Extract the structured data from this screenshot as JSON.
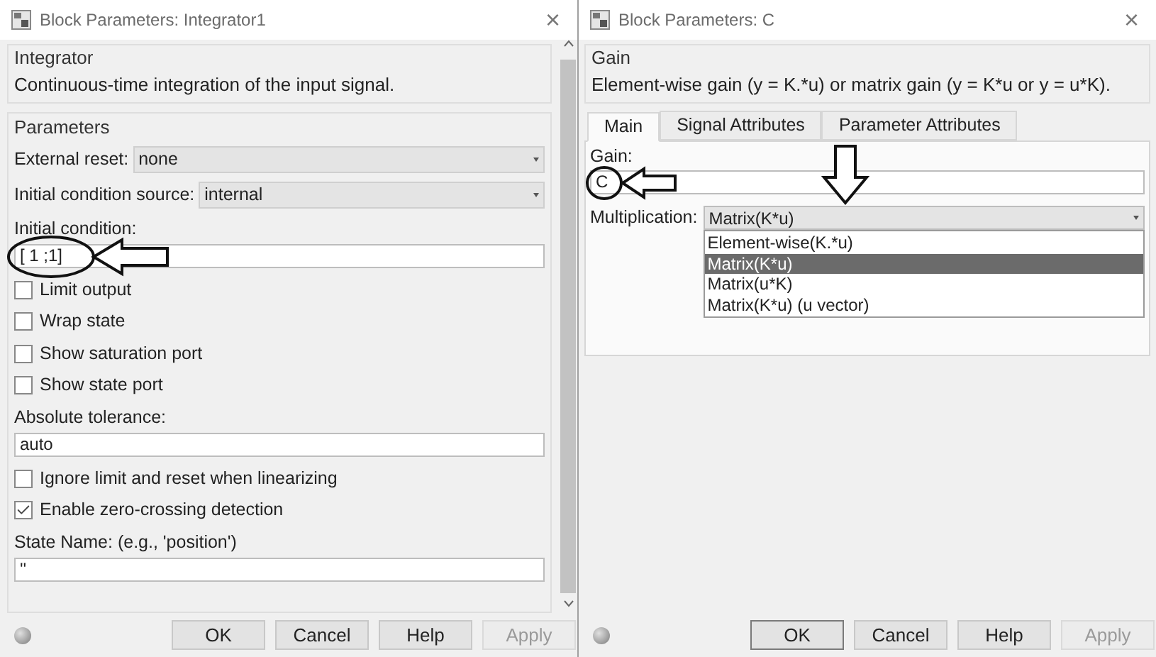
{
  "integrator_dialog": {
    "title": "Block Parameters: Integrator1",
    "close": "×",
    "block": {
      "name": "Integrator",
      "description": "Continuous-time integration of the input signal."
    },
    "group": "Parameters",
    "fields": [
      {
        "kind": "select",
        "label": "External reset:",
        "value": "none"
      },
      {
        "kind": "select",
        "label": "Initial condition source:",
        "value": "internal"
      },
      {
        "kind": "text",
        "label": "Initial condition:",
        "value": "[ 1 ;1]",
        "annotated": true
      },
      {
        "kind": "checkbox",
        "label": "Limit output",
        "checked": false
      },
      {
        "kind": "checkbox",
        "label": "Wrap state",
        "checked": false
      },
      {
        "kind": "checkbox",
        "label": "Show saturation port",
        "checked": false
      },
      {
        "kind": "checkbox",
        "label": "Show state port",
        "checked": false
      },
      {
        "kind": "text",
        "label": "Absolute tolerance:",
        "value": "auto",
        "annotated": false
      },
      {
        "kind": "checkbox",
        "label": "Ignore limit and reset when linearizing",
        "checked": false
      },
      {
        "kind": "checkbox",
        "label": "Enable zero-crossing detection",
        "checked": true
      },
      {
        "kind": "text",
        "label": "State Name: (e.g., 'position')",
        "value": "''",
        "annotated": false
      }
    ],
    "buttons": [
      {
        "label": "OK",
        "disabled": false,
        "focused": false
      },
      {
        "label": "Cancel",
        "disabled": false,
        "focused": false
      },
      {
        "label": "Help",
        "disabled": false,
        "focused": false
      },
      {
        "label": "Apply",
        "disabled": true,
        "focused": false
      }
    ]
  },
  "gain_dialog": {
    "title": "Block Parameters: C",
    "close": "×",
    "block": {
      "name": "Gain",
      "description": "Element-wise gain (y = K.*u) or matrix gain (y = K*u or y = u*K)."
    },
    "tabs": [
      {
        "label": "Main",
        "selected": true
      },
      {
        "label": "Signal Attributes",
        "selected": false
      },
      {
        "label": "Parameter Attributes",
        "selected": false
      }
    ],
    "gain": {
      "label": "Gain:",
      "value": "C",
      "annotated": true
    },
    "multiplication": {
      "label": "Multiplication:",
      "value": "Matrix(K*u)",
      "annotated": true,
      "expanded": true,
      "options": [
        {
          "label": "Element-wise(K.*u)",
          "selected": false
        },
        {
          "label": "Matrix(K*u)",
          "selected": true
        },
        {
          "label": "Matrix(u*K)",
          "selected": false
        },
        {
          "label": "Matrix(K*u) (u vector)",
          "selected": false
        }
      ]
    },
    "buttons": [
      {
        "label": "OK",
        "disabled": false,
        "focused": true
      },
      {
        "label": "Cancel",
        "disabled": false,
        "focused": false
      },
      {
        "label": "Help",
        "disabled": false,
        "focused": false
      },
      {
        "label": "Apply",
        "disabled": true,
        "focused": false
      }
    ]
  }
}
